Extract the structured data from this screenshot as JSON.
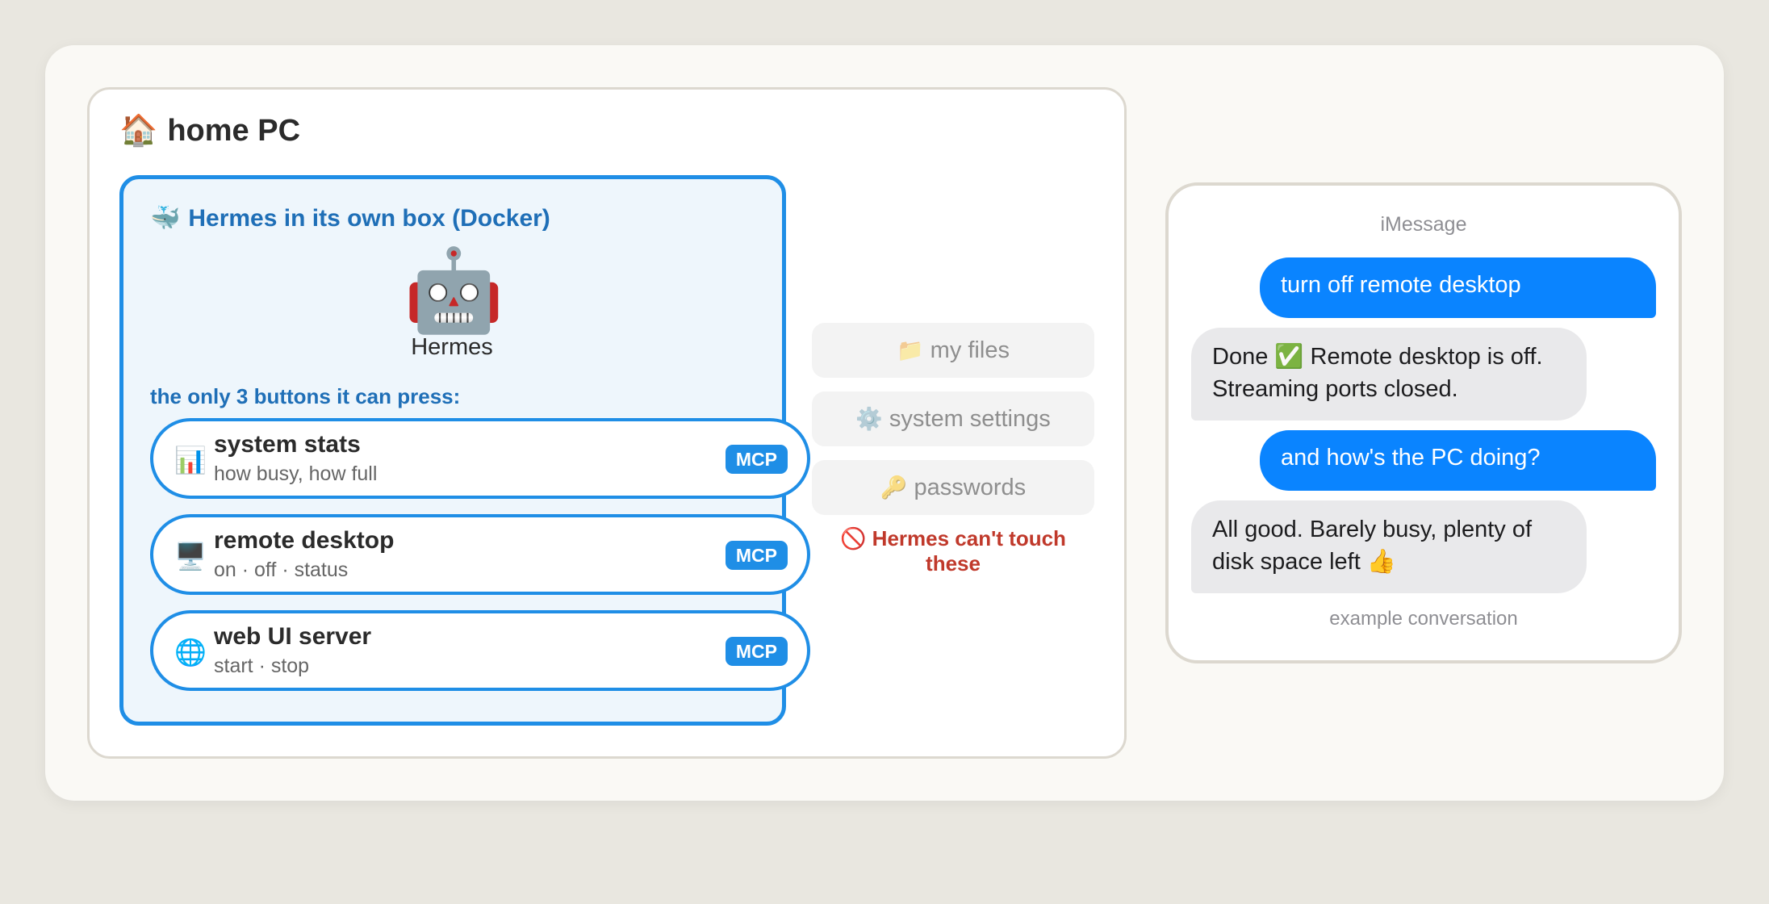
{
  "home": {
    "icon": "🏠",
    "title": "home PC"
  },
  "docker": {
    "icon": "🐳",
    "title": "Hermes in its own box (Docker)",
    "agent_icon": "🤖",
    "agent_name": "Hermes",
    "caption": "the only 3 buttons it can press:",
    "tools": [
      {
        "icon": "📊",
        "name": "system stats",
        "sub": "how busy, how full",
        "badge": "MCP"
      },
      {
        "icon": "🖥️",
        "name": "remote desktop",
        "sub": "on · off · status",
        "badge": "MCP"
      },
      {
        "icon": "🌐",
        "name": "web UI server",
        "sub": "start · stop",
        "badge": "MCP"
      }
    ]
  },
  "blocked": {
    "items": [
      {
        "icon": "📁",
        "label": "my files"
      },
      {
        "icon": "⚙️",
        "label": "system settings"
      },
      {
        "icon": "🔑",
        "label": "passwords"
      }
    ],
    "note_icon": "🚫",
    "note": "Hermes can't touch these"
  },
  "chat": {
    "app": "iMessage",
    "messages": [
      {
        "from": "me",
        "text": "turn off remote desktop"
      },
      {
        "from": "hermes",
        "text": "Done ✅ Remote desktop is off. Streaming ports closed."
      },
      {
        "from": "me",
        "text": "and how's the PC doing?"
      },
      {
        "from": "hermes",
        "text": "All good. Barely busy, plenty of disk space left 👍"
      }
    ],
    "footer": "example conversation"
  },
  "colors": {
    "accent": "#1f8ee6",
    "accent_text": "#1f6fb7",
    "warning": "#c0392b",
    "imessage_blue": "#0a84ff"
  }
}
